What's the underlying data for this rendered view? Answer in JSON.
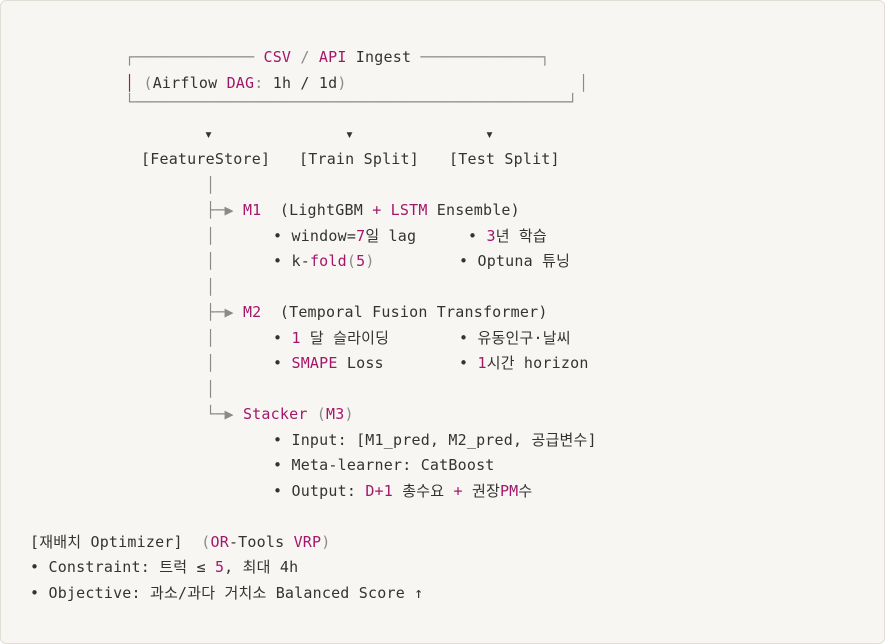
{
  "colors": {
    "background": "#f7f6f2",
    "text": "#333333",
    "accent": "#a3176a",
    "punctuation": "#8a8a8a"
  },
  "diagram": {
    "ingest": {
      "top_border_left": "┌───────────── ",
      "title_csv": "CSV",
      "title_sep": " / ",
      "title_api": "API",
      "title_rest": " Ingest",
      "top_border_right": " ─────────────┐",
      "left_bar": "│",
      "paren_open": " (",
      "airflow": "Airflow ",
      "dag": "DAG",
      "colon": ": ",
      "schedule": "1h / 1d",
      "paren_close": ")",
      "right_bar": "│",
      "bottom_border": "└───────────────────────────────────────────────┘"
    },
    "arrows": [
      "▾",
      "▾",
      "▾"
    ],
    "stages": [
      "[FeatureStore]",
      "[Train Split]",
      "[Test Split]"
    ],
    "tree": {
      "trunk": "│",
      "branch": "├─▶",
      "last_branch": "└─▶",
      "m1": {
        "label": "M1",
        "desc_prefix": "  (LightGBM ",
        "plus": "+",
        "lstm": " LSTM",
        "desc_suffix": " Ensemble)",
        "b1_pre": "• window=",
        "b1_num": "7",
        "b1_post": "일 lag",
        "b2_pre": "• ",
        "b2_num": "3",
        "b2_post": "년 학습",
        "b3_pre": "• k-",
        "b3_fold": "fold",
        "b3_paren_open": "(",
        "b3_num": "5",
        "b3_paren_close": ")",
        "b4": "• Optuna 튜닝"
      },
      "m2": {
        "label": "M2",
        "desc": "  (Temporal Fusion Transformer)",
        "b1_pre": "• ",
        "b1_num": "1",
        "b1_post": " 달 슬라이딩",
        "b2": "• 유동인구·날씨",
        "b3_pre": "• ",
        "b3_smape": "SMAPE",
        "b3_post": " Loss",
        "b4_pre": "• ",
        "b4_num": "1",
        "b4_post": "시간 horizon"
      },
      "stacker": {
        "label": "Stacker",
        "m3_open": " (",
        "m3": "M3",
        "m3_close": ")",
        "b1_pre": "• Input: [M1_pred, M2_pred, 공급변수]",
        "b2": "• Meta-learner: CatBoost",
        "b3_pre": "• Output: ",
        "b3_d1": "D+1",
        "b3_mid": " 총수요 ",
        "b3_plus": "+",
        "b3_post": " 권장",
        "b3_pm": "PM",
        "b3_end": "수"
      }
    },
    "optimizer": {
      "title": "[재배치 Optimizer]",
      "paren_open": "  (",
      "or": "OR",
      "tools": "-Tools ",
      "vrp": "VRP",
      "paren_close": ")",
      "constraint_pre": "• Constraint: 트럭 ≤ ",
      "constraint_num": "5",
      "constraint_post": ", 최대 4h",
      "objective": "• Objective: 과소/과다 거치소 Balanced Score ↑"
    }
  }
}
